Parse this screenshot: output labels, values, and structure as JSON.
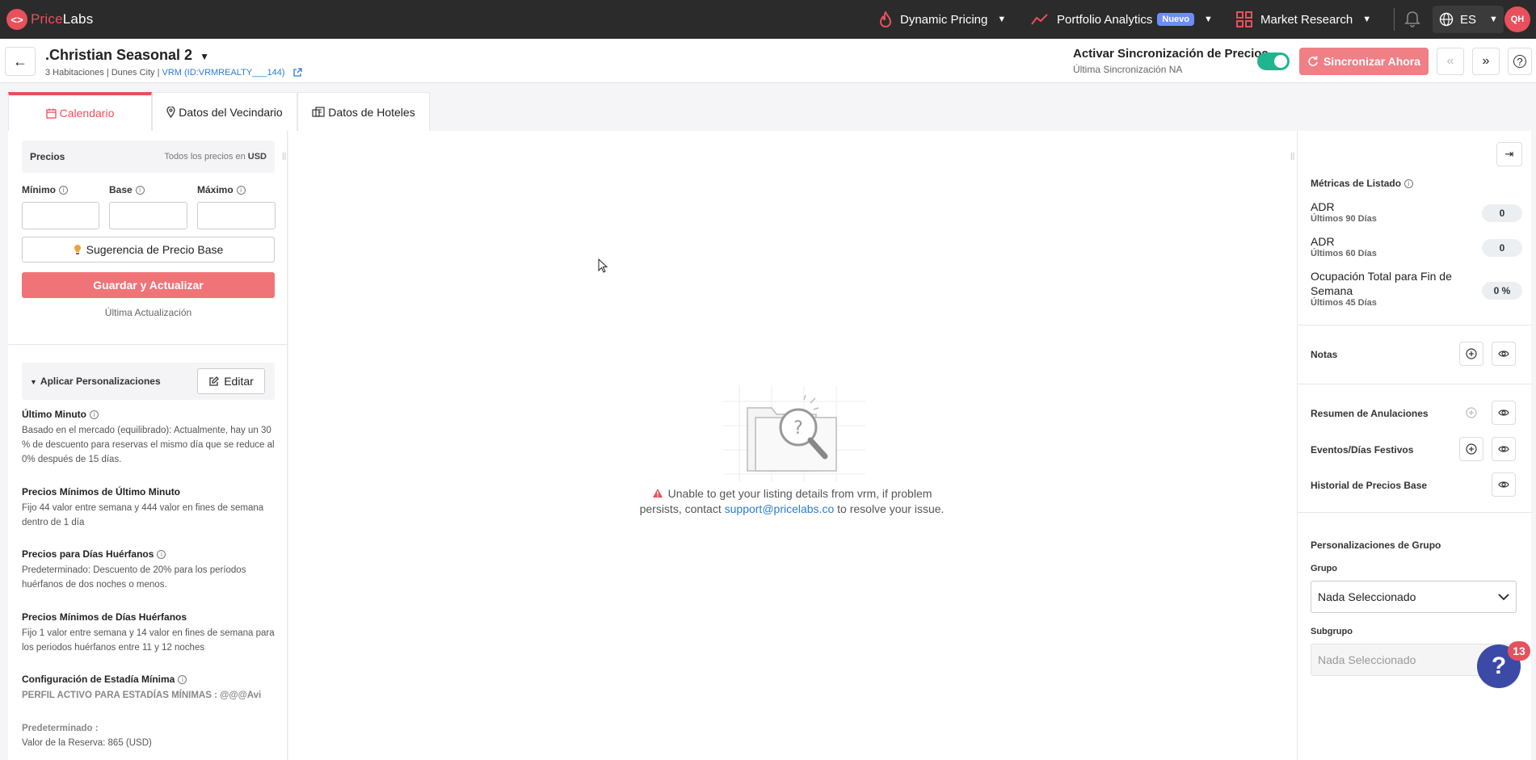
{
  "app": {
    "logo_mark": "<>",
    "logo_part1": "Price",
    "logo_part2": "Labs"
  },
  "nav": {
    "dynamic_pricing": "Dynamic Pricing",
    "portfolio_analytics": "Portfolio Analytics",
    "new_badge": "Nuevo",
    "market_research": "Market Research",
    "language": "ES",
    "avatar_initials": "QH"
  },
  "listing": {
    "title": ".Christian Seasonal 2",
    "subtitle_prefix": "3 Habitaciones | Dunes City | ",
    "pms_link": "VRM (ID:VRMREALTY___144)"
  },
  "sync": {
    "title": "Activar Sincronización de Precios",
    "last_sync": "Última Sincronización NA",
    "enabled": true,
    "sync_now_label": "Sincronizar Ahora"
  },
  "tabs": [
    {
      "label": "Calendario",
      "active": true
    },
    {
      "label": "Datos del Vecindario",
      "active": false
    },
    {
      "label": "Datos de Hoteles",
      "active": false
    }
  ],
  "prices": {
    "header": "Precios",
    "currency_note_prefix": "Todos los precios en ",
    "currency": "USD",
    "min_label": "Mínimo",
    "base_label": "Base",
    "max_label": "Máximo",
    "min_value": "",
    "base_value": "",
    "max_value": "",
    "suggest_label": "Sugerencia de Precio Base",
    "save_label": "Guardar y Actualizar",
    "last_update": "Última Actualización"
  },
  "customizations": {
    "header": "Aplicar Personalizaciones",
    "edit_label": "Editar",
    "rules": [
      {
        "title": "Último Minuto",
        "info": true,
        "desc": "Basado en el mercado (equilibrado): Actualmente, hay un 30 % de descuento para reservas el mismo día que se reduce al 0% después de 15 días."
      },
      {
        "title": "Precios Mínimos de Último Minuto",
        "info": false,
        "desc": "Fijo 44 valor entre semana y 444 valor en fines de semana dentro de 1 día"
      },
      {
        "title": "Precios para Días Huérfanos",
        "info": true,
        "desc": "Predeterminado: Descuento de 20% para los períodos huérfanos de dos noches o menos."
      },
      {
        "title": "Precios Mínimos de Días Huérfanos",
        "info": false,
        "desc": "Fijo 1 valor entre semana y 14 valor en fines de semana para los periodos huérfanos entre 11 y 12 noches"
      },
      {
        "title": "Configuración de Estadía Mínima",
        "info": true,
        "desc": "PERFIL ACTIVO PARA ESTADÍAS MÍNIMAS : @@@Avi"
      }
    ],
    "default_label": "Predeterminado :",
    "booking_value": "Valor de la Reserva: 865 (USD)"
  },
  "error": {
    "line1": "Unable to get your listing details from vrm, if problem",
    "line2_prefix": "persists, contact ",
    "email": "support@pricelabs.co",
    "line2_suffix": " to resolve your issue."
  },
  "metrics": {
    "header": "Métricas de Listado",
    "items": [
      {
        "name": "ADR",
        "period": "Últimos 90 Días",
        "value": "0"
      },
      {
        "name": "ADR",
        "period": "Últimos 60 Días",
        "value": "0"
      },
      {
        "name": "Ocupación Total para Fin de Semana",
        "period": "Últimos 45 Días",
        "value": "0 %"
      }
    ]
  },
  "side_rows": {
    "notes": "Notas",
    "cancellations": "Resumen de Anulaciones",
    "events": "Eventos/Días Festivos",
    "base_history": "Historial de Precios Base"
  },
  "group": {
    "header": "Personalizaciones de Grupo",
    "group_label": "Grupo",
    "group_value": "Nada Seleccionado",
    "subgroup_label": "Subgrupo",
    "subgroup_value": "Nada Seleccionado"
  },
  "help": {
    "count": "13"
  },
  "colors": {
    "brand": "#e8505b",
    "toggle_on": "#1fb58f",
    "link": "#2b7bd6"
  }
}
